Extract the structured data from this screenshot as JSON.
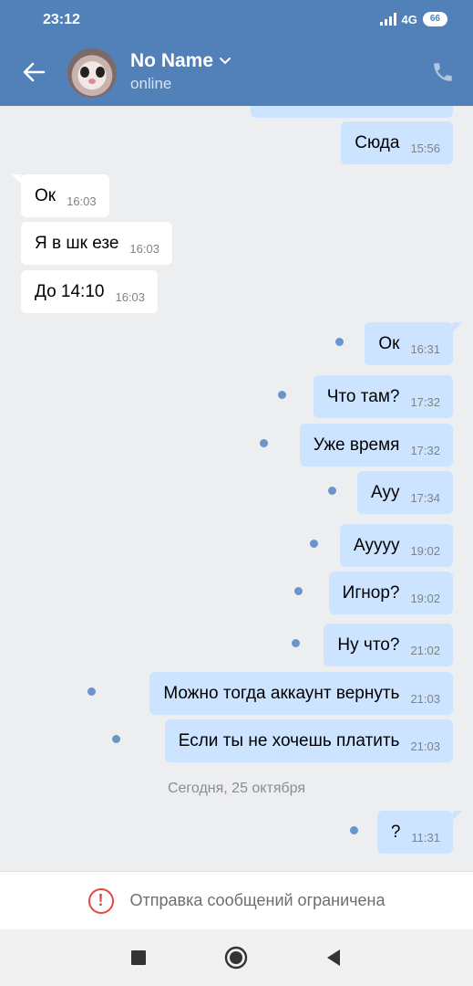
{
  "status_bar": {
    "time": "23:12",
    "network": "4G",
    "battery": "66"
  },
  "header": {
    "name": "No Name",
    "presence": "online"
  },
  "messages": [
    {
      "text": "Сюда",
      "time": "15:56"
    },
    {
      "text": "Ок",
      "time": "16:03"
    },
    {
      "text": "Я в шк езе",
      "time": "16:03"
    },
    {
      "text": "До 14:10",
      "time": "16:03"
    },
    {
      "text": "Ок",
      "time": "16:31"
    },
    {
      "text": "Что там?",
      "time": "17:32"
    },
    {
      "text": "Уже время",
      "time": "17:32"
    },
    {
      "text": "Ауу",
      "time": "17:34"
    },
    {
      "text": "Ауууу",
      "time": "19:02"
    },
    {
      "text": "Игнор?",
      "time": "19:02"
    },
    {
      "text": "Ну что?",
      "time": "21:02"
    },
    {
      "text": "Можно тогда аккаунт вернуть",
      "time": "21:03"
    },
    {
      "text": "Если ты не хочешь платить",
      "time": "21:03"
    },
    {
      "text": "?",
      "time": "11:31"
    }
  ],
  "date_separator": "Сегодня, 25 октября",
  "restriction": {
    "text": "Отправка сообщений ограничена",
    "icon": "warning-icon",
    "color": "#e64646"
  },
  "icons": {
    "back": "back-arrow-icon",
    "call": "phone-icon",
    "recents": "square-icon",
    "home": "circle-icon",
    "back_nav": "triangle-back-icon"
  },
  "colors": {
    "header": "#5181b8",
    "outgoing": "#cce4ff",
    "incoming": "#ffffff",
    "background": "#edeef0"
  }
}
